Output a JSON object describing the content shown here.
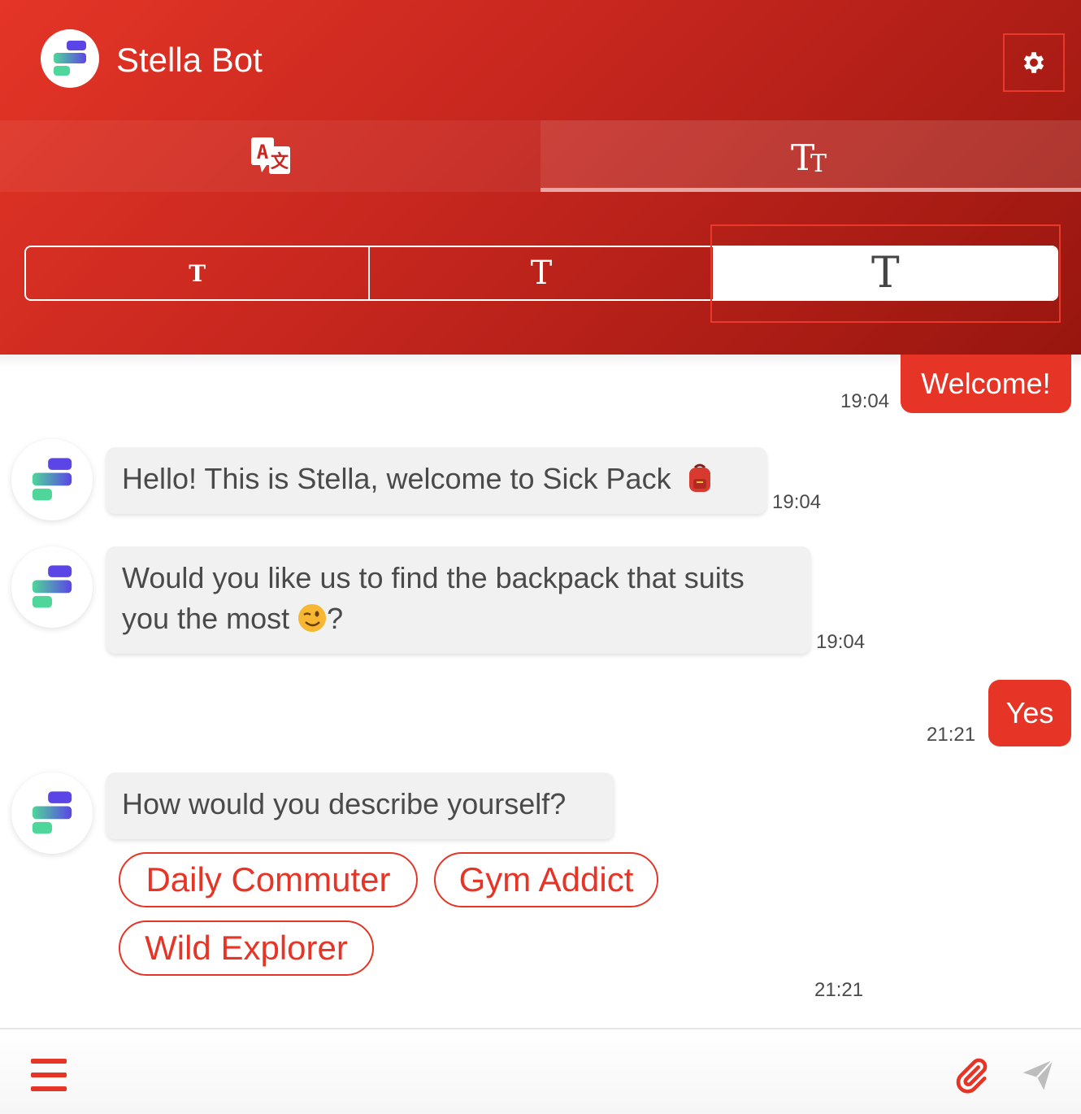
{
  "header": {
    "title": "Stella Bot",
    "settings_icon": "gear-icon"
  },
  "tabs": [
    {
      "icon": "translate-icon",
      "active": false
    },
    {
      "icon": "font-size-icon",
      "active": true
    }
  ],
  "font_size_options": [
    {
      "glyph": "T",
      "size": "small",
      "active": false
    },
    {
      "glyph": "T",
      "size": "medium",
      "active": false
    },
    {
      "glyph": "T",
      "size": "large",
      "active": true
    }
  ],
  "messages": [
    {
      "from": "user",
      "text": "Welcome!",
      "time": "19:04"
    },
    {
      "from": "bot",
      "text": "Hello! This is Stella, welcome to Sick Pack",
      "emoji": "backpack-icon",
      "time": "19:04"
    },
    {
      "from": "bot",
      "text_line1": "Would you like us to find the backpack that suits",
      "text_line2": "you the most",
      "emoji": "wink-icon",
      "text_after": "?",
      "time": "19:04"
    },
    {
      "from": "user",
      "text": "Yes",
      "time": "21:21"
    },
    {
      "from": "bot",
      "text": "How would you describe yourself?",
      "time": "21:21",
      "quick_replies": [
        "Daily Commuter",
        "Gym Addict",
        "Wild Explorer"
      ]
    }
  ],
  "footer": {
    "menu_icon": "menu-icon",
    "attach_icon": "paperclip-icon",
    "send_icon": "send-icon"
  },
  "colors": {
    "accent": "#e63426",
    "header_dark": "#98160f",
    "bot_bubble": "#f1f1f1",
    "text": "#4a4a4a",
    "logo_purple": "#5b45e6",
    "logo_green": "#4fd69a"
  }
}
